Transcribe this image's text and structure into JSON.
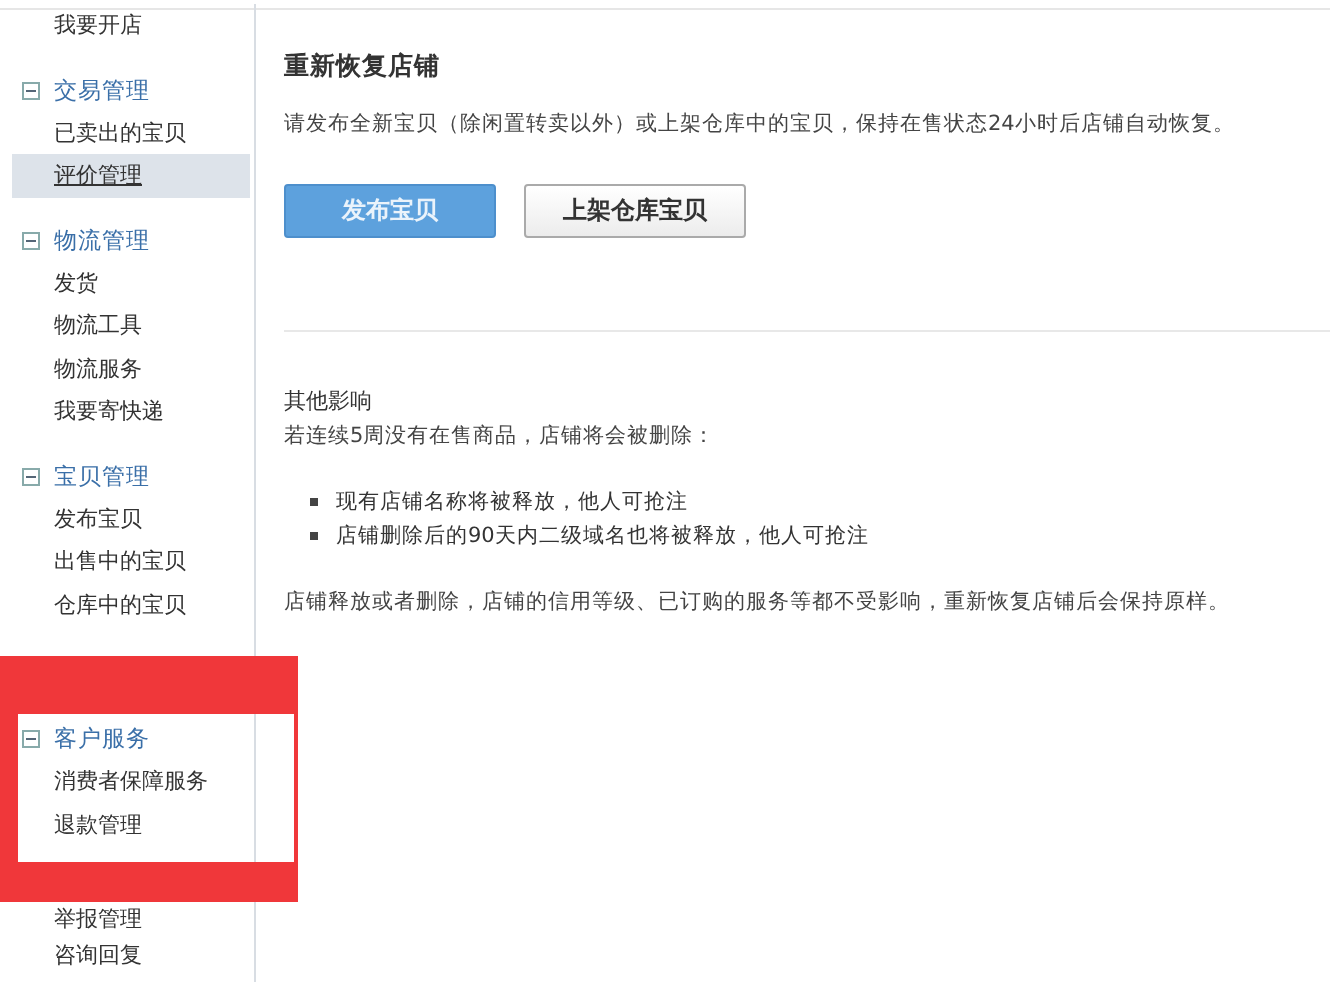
{
  "sidebar": {
    "groups": [
      {
        "items": [
          {
            "label": "我要开店",
            "selected": false
          }
        ]
      },
      {
        "title": "交易管理",
        "expanded": true,
        "items": [
          {
            "label": "已卖出的宝贝",
            "selected": false
          },
          {
            "label": "评价管理",
            "selected": true
          }
        ]
      },
      {
        "title": "物流管理",
        "expanded": true,
        "items": [
          {
            "label": "发货",
            "selected": false
          },
          {
            "label": "物流工具",
            "selected": false
          },
          {
            "label": "物流服务",
            "selected": false
          },
          {
            "label": "我要寄快递",
            "selected": false
          }
        ]
      },
      {
        "title": "宝贝管理",
        "expanded": true,
        "items": [
          {
            "label": "发布宝贝",
            "selected": false
          },
          {
            "label": "出售中的宝贝",
            "selected": false
          },
          {
            "label": "仓库中的宝贝",
            "selected": false
          }
        ]
      },
      {
        "title": "客户服务",
        "expanded": true,
        "items": [
          {
            "label": "消费者保障服务",
            "selected": false
          },
          {
            "label": "退款管理",
            "selected": false
          }
        ]
      },
      {
        "items": [
          {
            "label": "举报管理",
            "selected": false
          },
          {
            "label": "咨询回复",
            "selected": false
          }
        ]
      }
    ]
  },
  "main": {
    "title": "重新恢复店铺",
    "description": "请发布全新宝贝（除闲置转卖以外）或上架仓库中的宝贝，保持在售状态24小时后店铺自动恢复。",
    "buttons": [
      {
        "label": "发布宝贝",
        "kind": "primary"
      },
      {
        "label": "上架仓库宝贝",
        "kind": "secondary"
      }
    ],
    "other": {
      "title": "其他影响",
      "intro": "若连续5周没有在售商品，店铺将会被删除：",
      "bullets": [
        "现有店铺名称将被释放，他人可抢注",
        "店铺删除后的90天内二级域名也将被释放，他人可抢注"
      ],
      "note": "店铺释放或者删除，店铺的信用等级、已订购的服务等都不受影响，重新恢复店铺后会保持原样。"
    }
  }
}
